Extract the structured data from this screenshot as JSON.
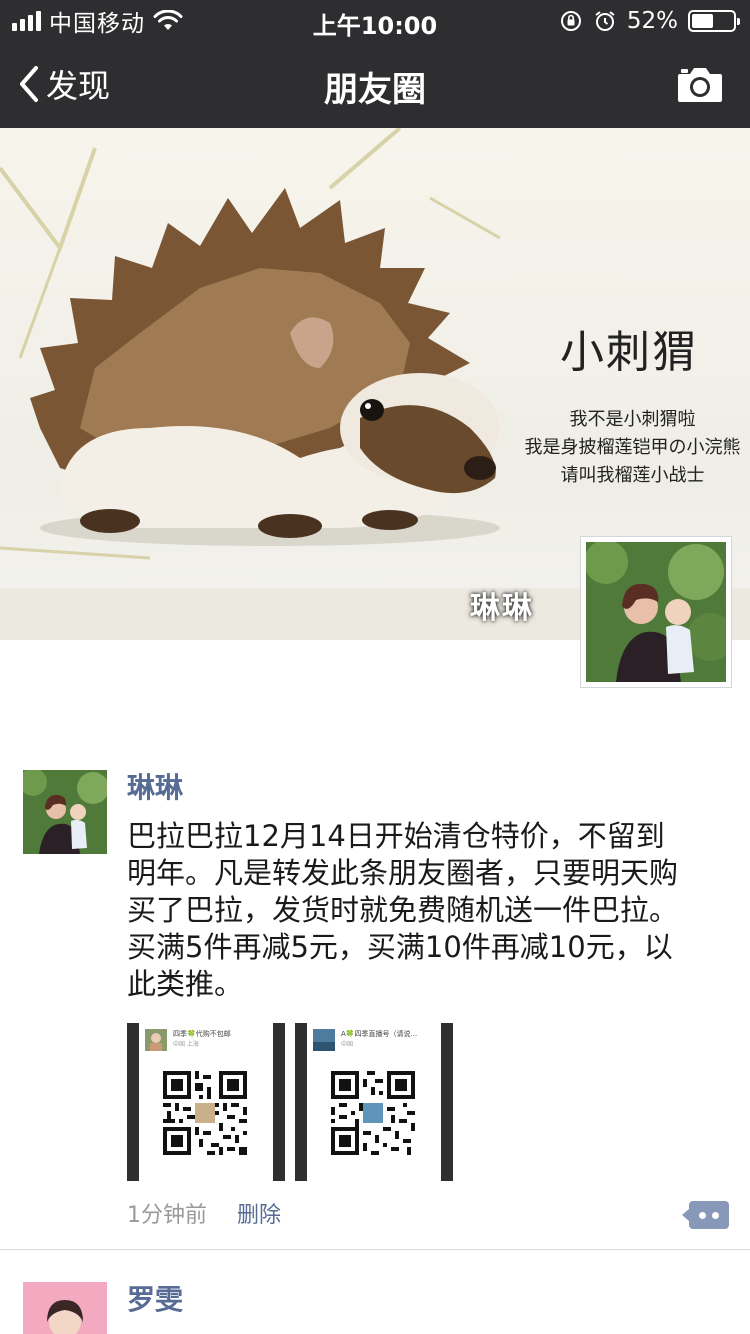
{
  "status_bar": {
    "carrier": "中国移动",
    "time": "上午10:00",
    "battery_percent": "52%",
    "battery_level": 0.52,
    "icons": [
      "signal-icon",
      "wifi-icon",
      "orientation-lock-icon",
      "alarm-icon",
      "battery-icon"
    ]
  },
  "nav": {
    "back_label": "发现",
    "title": "朋友圈",
    "right_icon": "camera-icon"
  },
  "cover": {
    "title": "小刺猬",
    "lines": [
      "我不是小刺猬啦",
      "我是身披榴莲铠甲の小浣熊",
      "请叫我榴莲小战士"
    ],
    "owner_name": "琳琳"
  },
  "post": {
    "author": "琳琳",
    "text": "巴拉巴拉12月14日开始清仓特价，不留到明年。凡是转发此条朋友圈者，只要明天购买了巴拉，发货时就免费随机送一件巴拉。买满5件再减5元，买满10件再减10元，以此类推。",
    "images": [
      {
        "header": "四季🍀代购不包邮",
        "sub": "中国 上海"
      },
      {
        "header": "A🍀四季直播号（请说...",
        "sub": "中国"
      }
    ],
    "time": "1分钟前",
    "delete_label": "删除"
  },
  "next_post": {
    "author": "罗雯"
  },
  "colors": {
    "bar_bg": "#2e2e30",
    "link": "#576b95",
    "meta": "#999999",
    "comment_btn": "#8798b8"
  }
}
